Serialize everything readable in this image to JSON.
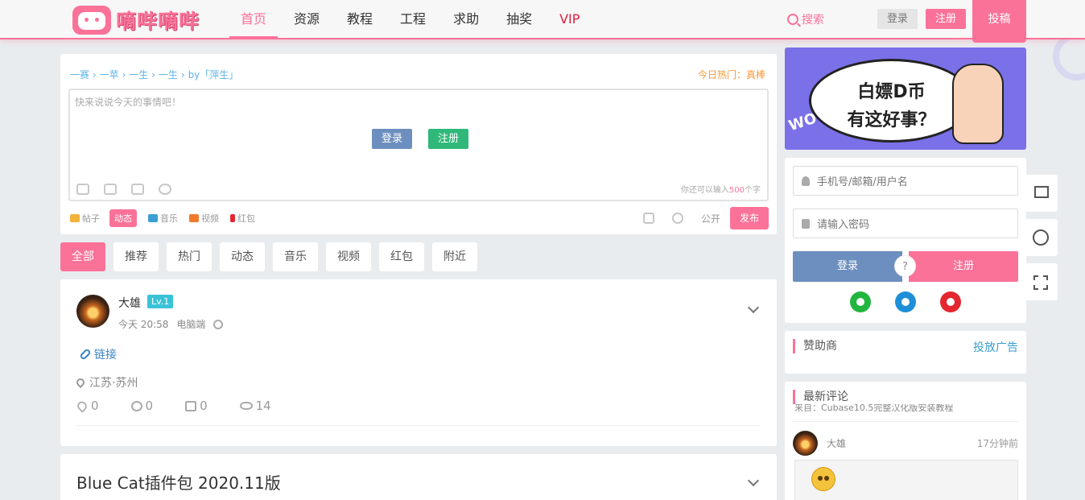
{
  "header": {
    "logo_text": "嘀哔嘀哔",
    "nav": [
      {
        "label": "首页",
        "active": true
      },
      {
        "label": "资源",
        "active": false
      },
      {
        "label": "教程",
        "active": false
      },
      {
        "label": "工程",
        "active": false
      },
      {
        "label": "求助",
        "active": false
      },
      {
        "label": "抽奖",
        "active": false
      },
      {
        "label": "VIP",
        "active": false
      }
    ],
    "search_label": "搜索",
    "login_label": "登录",
    "register_label": "注册",
    "submit_label": "投稿",
    "accent_color": "#fb7299"
  },
  "composer": {
    "breadcrumbs": [
      "一赛",
      "一苹",
      "一生",
      "一生",
      "by「萍生」"
    ],
    "today_hot": "今日热门：真棒",
    "placeholder": "快来说说今天的事情吧！",
    "login_label": "登录",
    "register_label": "注册",
    "count_prefix": "你还可以输入",
    "count_value": "500",
    "count_suffix": "个字",
    "types": [
      {
        "label": "帖子",
        "active": false,
        "color": "#f3b23a"
      },
      {
        "label": "动态",
        "active": true,
        "color": "#fff"
      },
      {
        "label": "音乐",
        "active": false,
        "color": "#3b9fd4"
      },
      {
        "label": "视频",
        "active": false,
        "color": "#f07a2a"
      },
      {
        "label": "红包",
        "active": false,
        "color": "#e3262f"
      }
    ],
    "visibility": "公开",
    "publish_label": "发布"
  },
  "tabs": [
    "全部",
    "推荐",
    "热门",
    "动态",
    "音乐",
    "视频",
    "红包",
    "附近"
  ],
  "post": {
    "author": "大雄",
    "level": "Lv.1",
    "time": "今天 20:58",
    "device": "电脑端",
    "link_label": "链接",
    "location": "江苏·苏州",
    "likes": "0",
    "comments": "0",
    "shares": "0",
    "views": "14"
  },
  "post2": {
    "title": "Blue Cat插件包 2020.11版"
  },
  "sidebar": {
    "banner_line1": "白嫖D币",
    "banner_line2": "有这好事？",
    "banner_wow": "WOW!",
    "username_placeholder": "手机号/邮箱/用户名",
    "password_placeholder": "请输入密码",
    "login_label": "登录",
    "or_label": "?",
    "register_label": "注册",
    "sponsor_title": "赞助商",
    "ad_link": "投放广告",
    "comments_title": "最新评论",
    "comment_preview": "来自：Cubase10.5完整汉化版安装教程",
    "comment_author": "大雄",
    "comment_time": "17分钟前"
  }
}
